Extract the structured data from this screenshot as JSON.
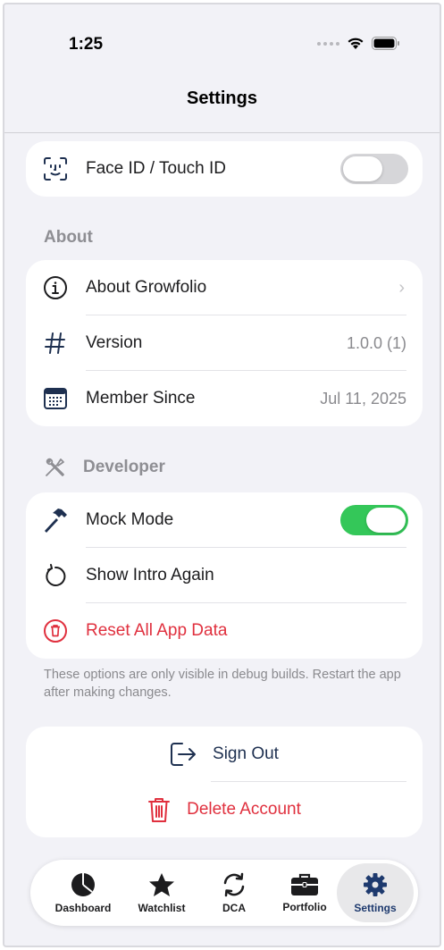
{
  "status_bar": {
    "time": "1:25"
  },
  "nav": {
    "title": "Settings"
  },
  "security": {
    "face_id": {
      "label": "Face ID / Touch ID",
      "enabled": false,
      "icon": "face-id-icon"
    }
  },
  "about": {
    "header": "About",
    "items": [
      {
        "label": "About Growfolio",
        "value": "",
        "icon": "info-icon"
      },
      {
        "label": "Version",
        "value": "1.0.0 (1)",
        "icon": "hash-icon"
      },
      {
        "label": "Member Since",
        "value": "Jul 11, 2025",
        "icon": "calendar-icon"
      }
    ]
  },
  "developer": {
    "header": "Developer",
    "items": [
      {
        "label": "Mock Mode",
        "enabled": true,
        "icon": "hammer-icon"
      },
      {
        "label": "Show Intro Again",
        "icon": "restart-icon"
      },
      {
        "label": "Reset All App Data",
        "icon": "trash-circle-icon",
        "destructive": true
      }
    ],
    "footer": "These options are only visible in debug builds. Restart the app after making changes."
  },
  "account": {
    "sign_out": "Sign Out",
    "delete": "Delete Account"
  },
  "tabbar": {
    "tabs": [
      {
        "label": "Dashboard",
        "icon": "pie-chart-icon"
      },
      {
        "label": "Watchlist",
        "icon": "star-icon"
      },
      {
        "label": "DCA",
        "icon": "sync-icon"
      },
      {
        "label": "Portfolio",
        "icon": "briefcase-icon"
      },
      {
        "label": "Settings",
        "icon": "gear-icon",
        "active": true
      }
    ]
  },
  "colors": {
    "accent": "#1e3050",
    "destructive": "#e0303e",
    "toggle_on": "#34c759",
    "background": "#f2f2f7"
  }
}
